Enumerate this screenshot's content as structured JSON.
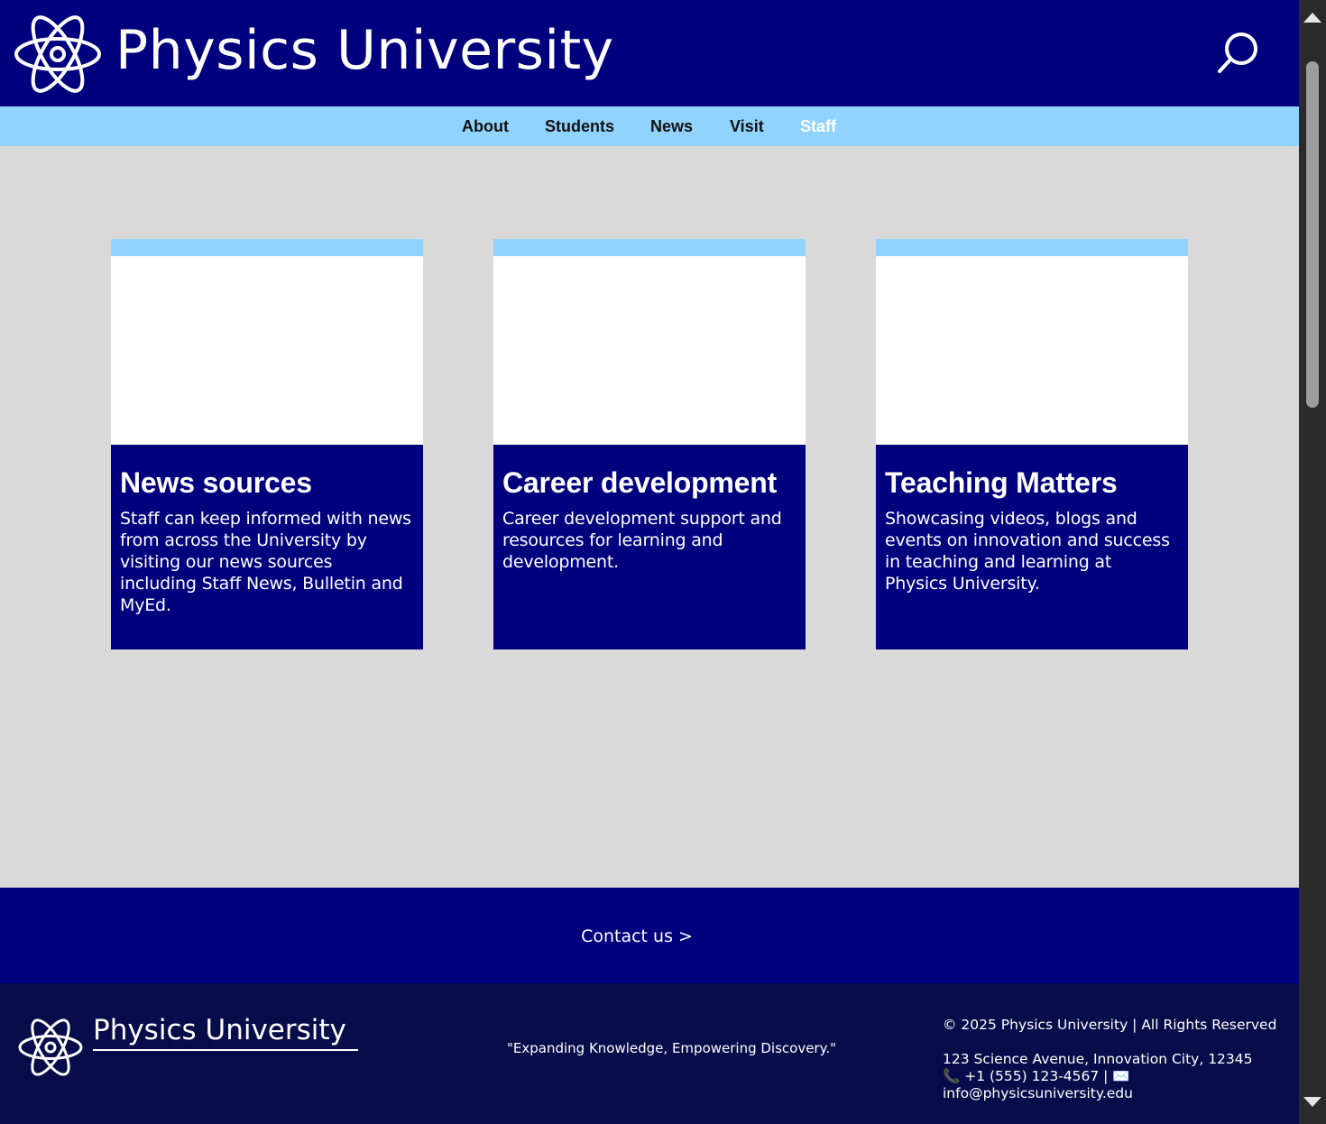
{
  "header": {
    "site_title": "Physics University",
    "logo_icon": "atom-icon",
    "search_icon": "search-icon"
  },
  "nav": {
    "items": [
      {
        "label": "About",
        "active": false
      },
      {
        "label": "Students",
        "active": false
      },
      {
        "label": "News",
        "active": false
      },
      {
        "label": "Visit",
        "active": false
      },
      {
        "label": "Staff",
        "active": true
      }
    ]
  },
  "cards": [
    {
      "title": "News sources",
      "text": "Staff can keep informed with news from across the University by visiting our news sources including Staff News, Bulletin and MyEd."
    },
    {
      "title": "Career development",
      "text": "Career development support and resources for learning and development."
    },
    {
      "title": "Teaching Matters",
      "text": "Showcasing videos, blogs and events on innovation and success in teaching and learning at Physics University."
    }
  ],
  "contact": {
    "label": "Contact us >"
  },
  "footer": {
    "title": "Physics University",
    "tagline": "\"Expanding Knowledge, Empowering Discovery.\"",
    "copyright": "© 2025 Physics University | All Rights Reserved",
    "address": "123 Science Avenue, Innovation City, 12345",
    "phone": "📞 +1 (555) 123-4567 | ✉️",
    "email": "info@physicsuniversity.edu"
  },
  "colors": {
    "header_bg": "#00007f",
    "nav_bg": "#90d3ff",
    "page_bg": "#d9d9d9",
    "card_bg": "#00007f",
    "footer_bg": "#070d4a",
    "active_nav": "#ffffff"
  }
}
